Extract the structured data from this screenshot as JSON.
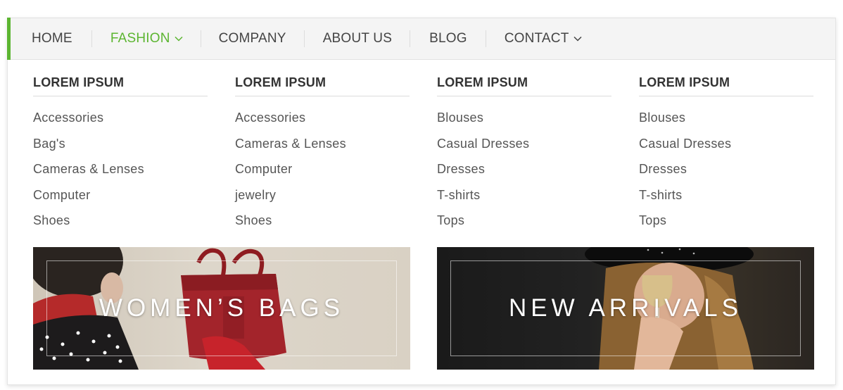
{
  "colors": {
    "accent": "#5cb531",
    "nav_bg": "#f4f4f4",
    "text": "#444444"
  },
  "nav": {
    "items": [
      {
        "label": "HOME",
        "active": false,
        "has_dropdown": false
      },
      {
        "label": "FASHION",
        "active": true,
        "has_dropdown": true
      },
      {
        "label": "COMPANY",
        "active": false,
        "has_dropdown": false
      },
      {
        "label": "ABOUT US",
        "active": false,
        "has_dropdown": false
      },
      {
        "label": "BLOG",
        "active": false,
        "has_dropdown": false
      },
      {
        "label": "CONTACT",
        "active": false,
        "has_dropdown": true
      }
    ]
  },
  "mega_menu": {
    "columns": [
      {
        "title": "LOREM IPSUM",
        "links": [
          "Accessories",
          "Bag's",
          "Cameras & Lenses",
          "Computer",
          "Shoes"
        ]
      },
      {
        "title": "LOREM IPSUM",
        "links": [
          "Accessories",
          "Cameras & Lenses",
          "Computer",
          "jewelry",
          "Shoes"
        ]
      },
      {
        "title": "LOREM IPSUM",
        "links": [
          "Blouses",
          "Casual Dresses",
          "Dresses",
          "T-shirts",
          "Tops"
        ]
      },
      {
        "title": "LOREM IPSUM",
        "links": [
          "Blouses",
          "Casual Dresses",
          "Dresses",
          "T-shirts",
          "Tops"
        ]
      }
    ],
    "banners": [
      {
        "label": "WOMEN’S BAGS"
      },
      {
        "label": "NEW ARRIVALS"
      }
    ]
  }
}
